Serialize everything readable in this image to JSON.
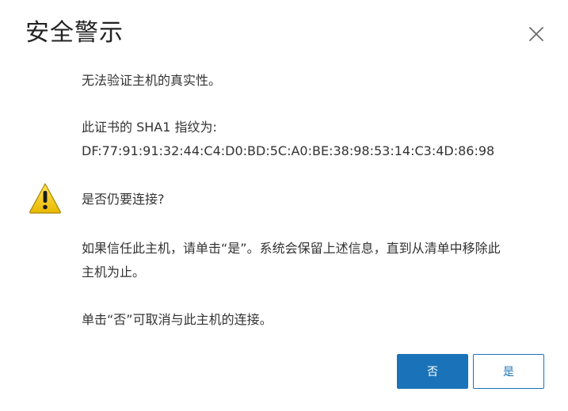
{
  "dialog": {
    "title": "安全警示",
    "close_icon": "close-icon",
    "warning_icon": "warning-icon",
    "accent_color": "#1a73b8",
    "warning_color": "#f2c500",
    "messages": {
      "unverified": "无法验证主机的真实性。",
      "fingerprint_label": "此证书的 SHA1 指纹为:",
      "fingerprint_value": "DF:77:91:91:32:44:C4:D0:BD:5C:A0:BE:38:98:53:14:C3:4D:86:98",
      "continue_question": "是否仍要连接?",
      "trust_line1": "如果信任此主机，请单击“是”。系统会保留上述信息，直到从清单中移除此",
      "trust_line2": "主机为止。",
      "no_hint": "单击“否”可取消与此主机的连接。"
    },
    "buttons": {
      "no_label": "否",
      "yes_label": "是"
    }
  }
}
